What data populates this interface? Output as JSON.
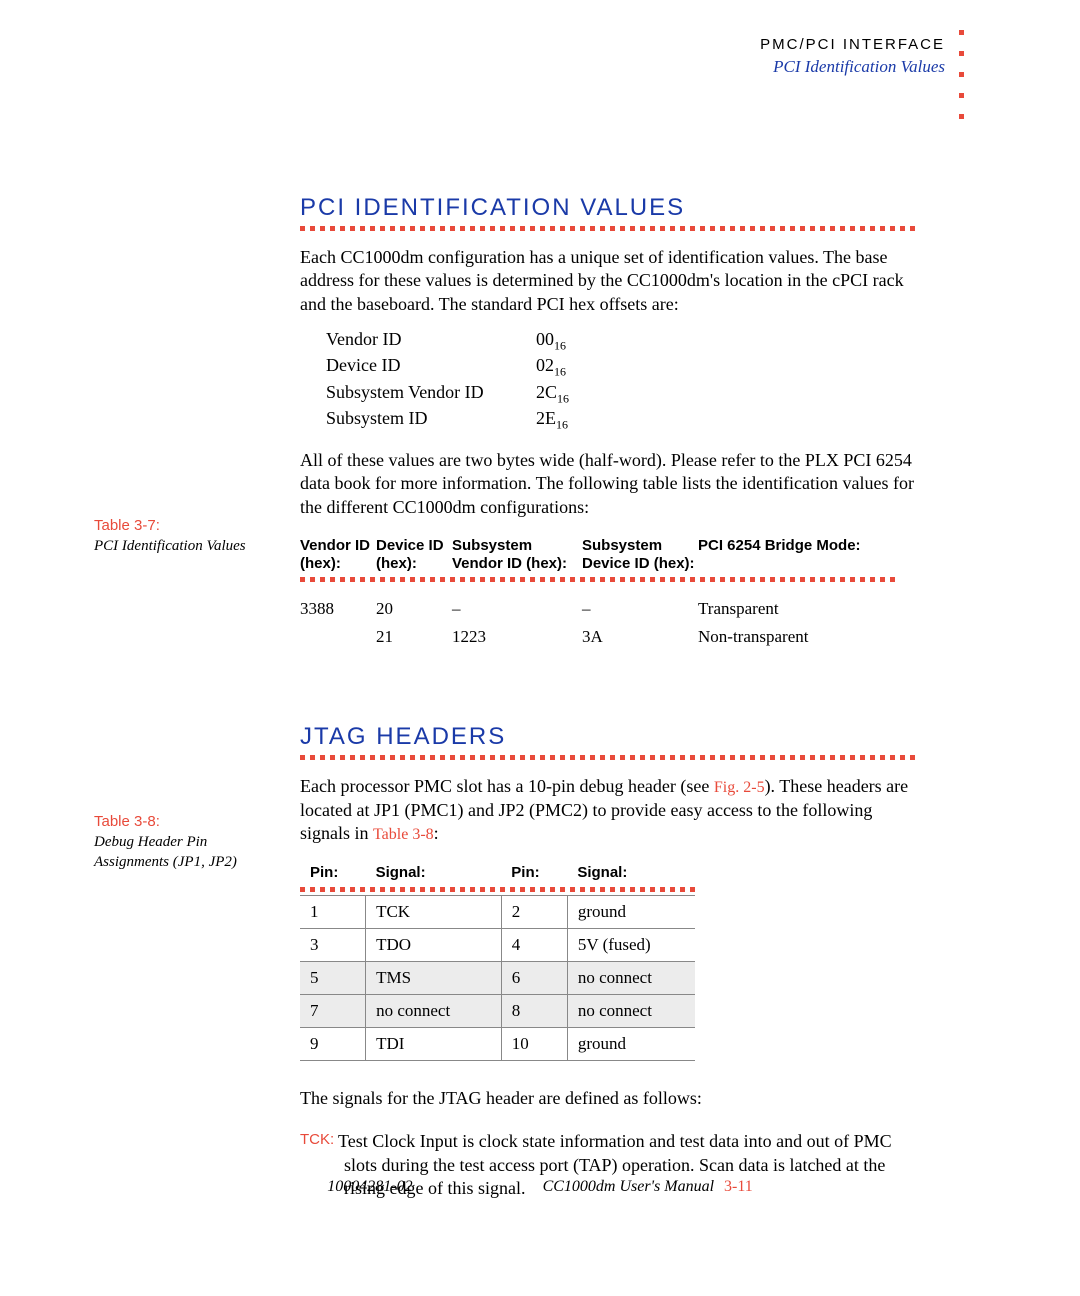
{
  "header": {
    "chapter": "PMC/PCI INTERFACE",
    "section": "PCI Identification Values"
  },
  "section1": {
    "title": "PCI IDENTIFICATION VALUES",
    "para1": "Each CC1000dm configuration has a unique set of identification values. The base address for these values is determined by the CC1000dm's location in the cPCI rack and the baseboard. The standard PCI hex offsets are:",
    "offsets": [
      {
        "label": "Vendor ID",
        "val": "00",
        "sub": "16"
      },
      {
        "label": "Device ID",
        "val": "02",
        "sub": "16"
      },
      {
        "label": "Subsystem Vendor ID",
        "val": "2C",
        "sub": "16"
      },
      {
        "label": "Subsystem ID",
        "val": "2E",
        "sub": "16"
      }
    ],
    "para2": "All of these values are two bytes wide (half-word). Please refer to the PLX PCI 6254 data book for more information. The following table lists the identification values for the different CC1000dm configurations:"
  },
  "table37": {
    "side_num": "Table 3-7:",
    "side_title": "PCI Identification Values",
    "headers": [
      "Vendor ID (hex):",
      "Device ID (hex):",
      "Subsystem Vendor ID (hex):",
      "Subsystem Device ID (hex):",
      "PCI 6254 Bridge Mode:"
    ],
    "rows": [
      [
        "3388",
        "20",
        "–",
        "–",
        "Transparent"
      ],
      [
        "",
        "21",
        "1223",
        "3A",
        "Non-transparent"
      ]
    ]
  },
  "section2": {
    "title": "JTAG HEADERS",
    "para1_a": "Each processor PMC slot has a 10-pin debug header (see ",
    "link1": "Fig. 2-5",
    "para1_b": "). These headers are located at JP1 (PMC1) and JP2 (PMC2) to provide easy access to the following signals in ",
    "link2": "Table 3-8",
    "para1_c": ":"
  },
  "table38": {
    "side_num": "Table 3-8:",
    "side_title": "Debug Header Pin Assignments (JP1, JP2)",
    "headers": [
      "Pin:",
      "Signal:",
      "Pin:",
      "Signal:"
    ],
    "rows": [
      {
        "cells": [
          "1",
          "TCK",
          "2",
          "ground"
        ],
        "shade": false
      },
      {
        "cells": [
          "3",
          "TDO",
          "4",
          "5V (fused)"
        ],
        "shade": false
      },
      {
        "cells": [
          "5",
          "TMS",
          "6",
          "no connect"
        ],
        "shade": true
      },
      {
        "cells": [
          "7",
          "no connect",
          "8",
          "no connect"
        ],
        "shade": true
      },
      {
        "cells": [
          "9",
          "TDI",
          "10",
          "ground"
        ],
        "shade": false
      }
    ]
  },
  "para3": "The signals for the JTAG header are defined as follows:",
  "def": {
    "term": "TCK:",
    "text": "Test Clock Input is clock state information and test data into and out of PMC slots during the test access port (TAP) operation. Scan data is latched at the rising edge of this signal."
  },
  "footer": {
    "docnum": "10004281-02",
    "manual": "CC1000dm User's Manual",
    "page": "3-11"
  }
}
